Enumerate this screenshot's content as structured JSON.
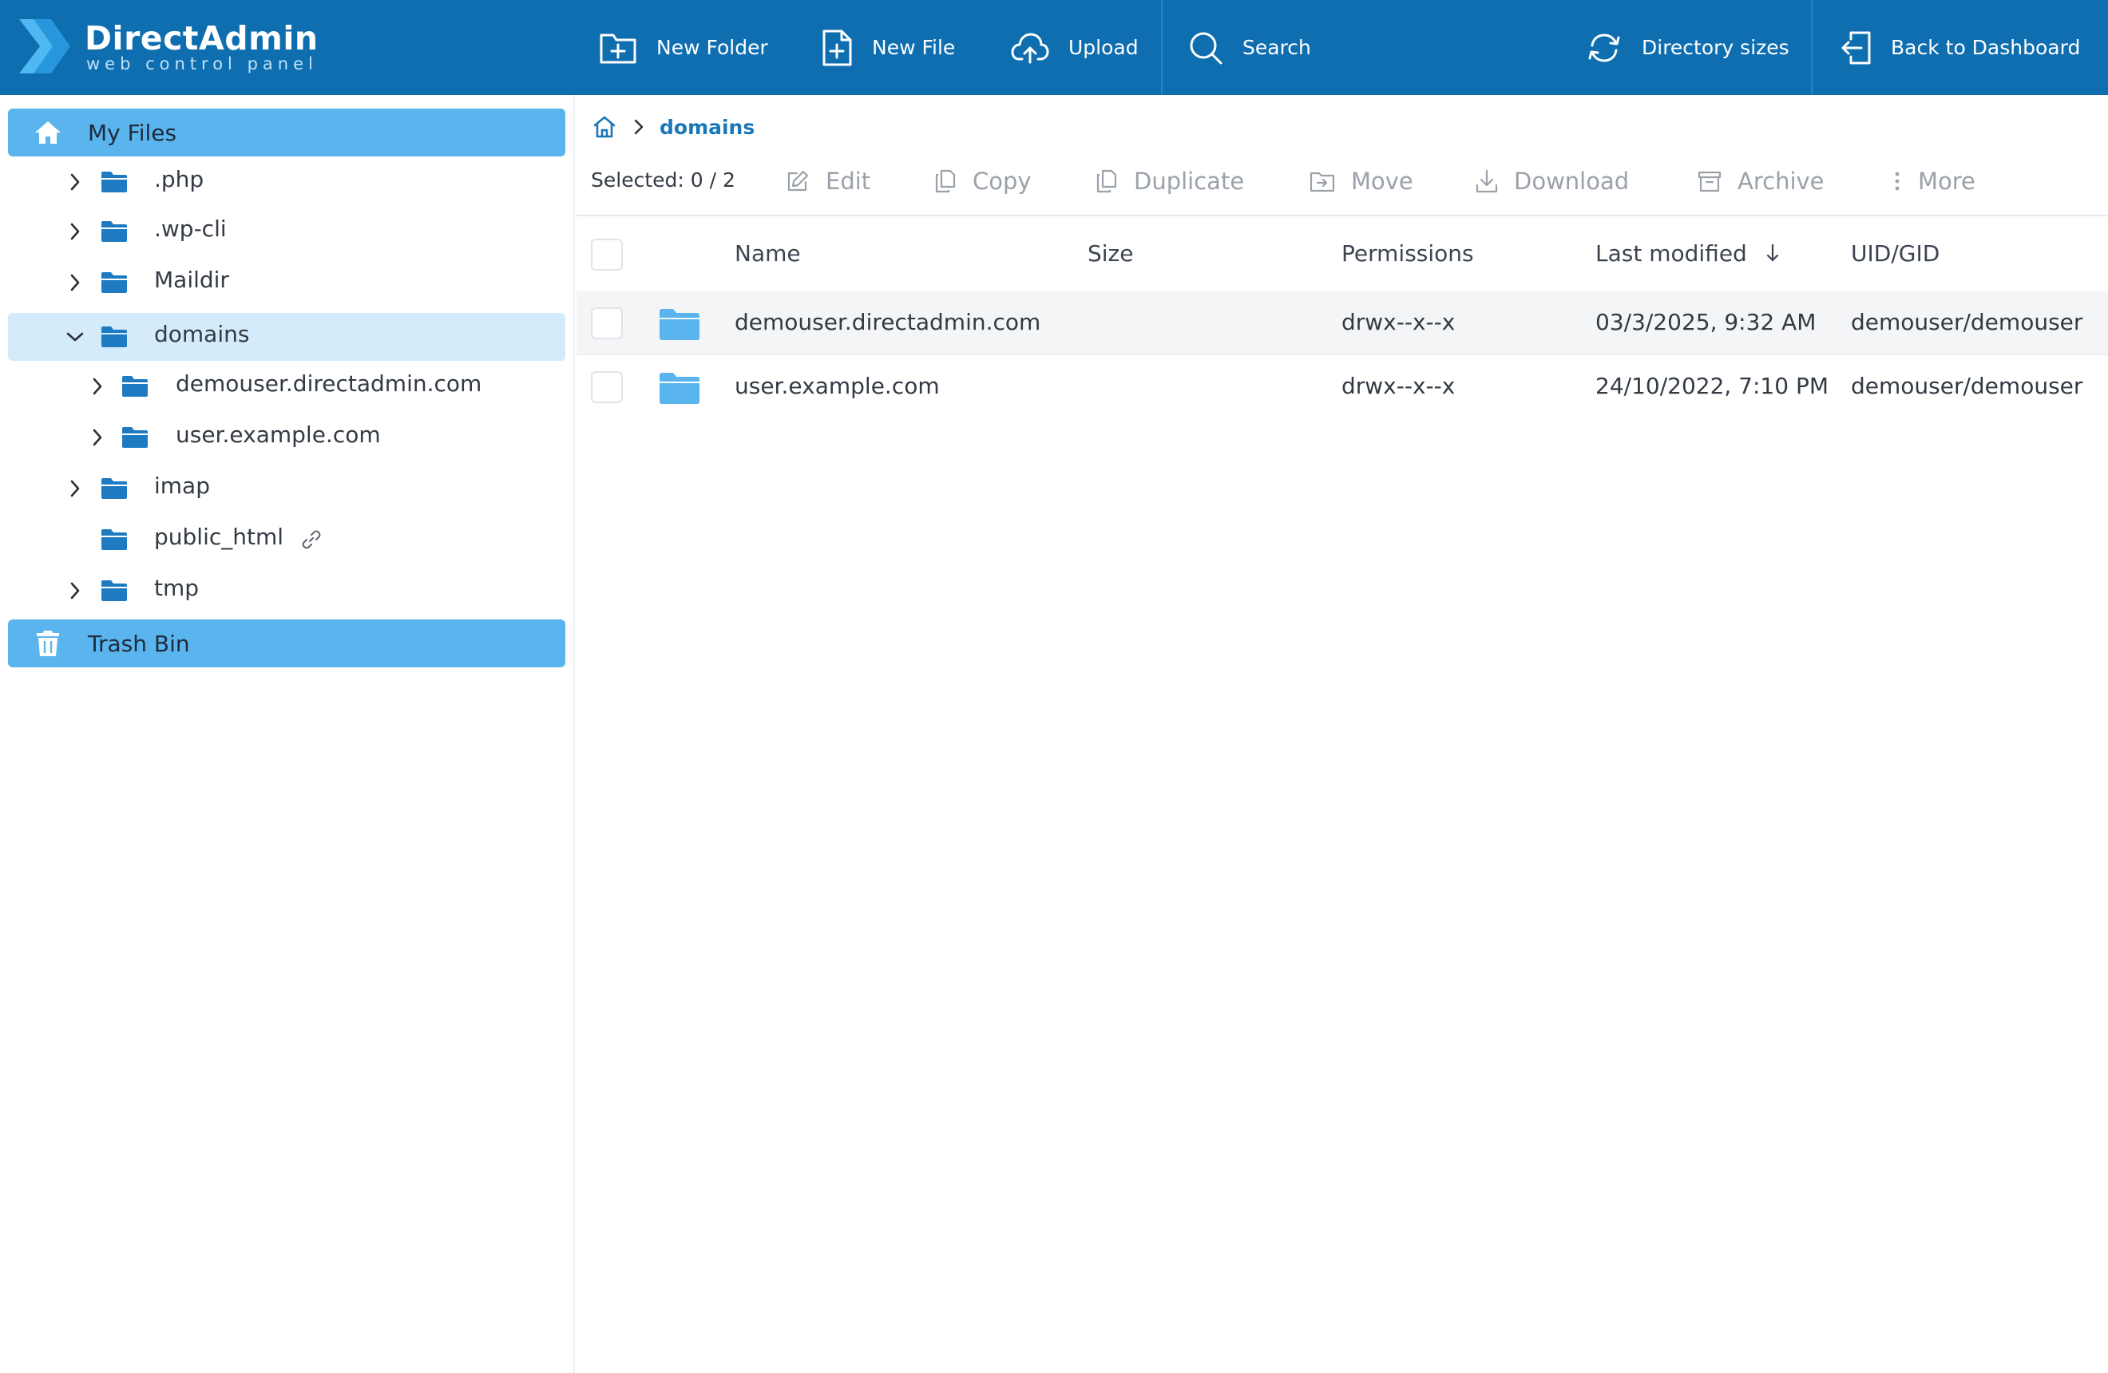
{
  "header": {
    "logo_title": "DirectAdmin",
    "logo_subtitle": "web control panel",
    "buttons": {
      "new_folder": "New Folder",
      "new_file": "New File",
      "upload": "Upload",
      "search": "Search",
      "directory_sizes": "Directory sizes",
      "back_to_dashboard": "Back to Dashboard"
    }
  },
  "sidebar": {
    "my_files": "My Files",
    "trash_bin": "Trash Bin",
    "tree": {
      "php": ".php",
      "wpcli": ".wp-cli",
      "maildir": "Maildir",
      "domains": "domains",
      "demouser": "demouser.directadmin.com",
      "userexample": "user.example.com",
      "imap": "imap",
      "public_html": "public_html",
      "tmp": "tmp"
    }
  },
  "breadcrumb": {
    "current": "domains"
  },
  "actions": {
    "selected_label": "Selected:",
    "selected_count": "0 / 2",
    "edit": "Edit",
    "copy": "Copy",
    "duplicate": "Duplicate",
    "move": "Move",
    "download": "Download",
    "archive": "Archive",
    "more": "More"
  },
  "table": {
    "columns": {
      "name": "Name",
      "size": "Size",
      "permissions": "Permissions",
      "last_modified": "Last modified",
      "uid_gid": "UID/GID"
    },
    "rows": [
      {
        "name": "demouser.directadmin.com",
        "size": "",
        "permissions": "drwx--x--x",
        "modified": "03/3/2025, 9:32 AM",
        "owner": "demouser/demouser"
      },
      {
        "name": "user.example.com",
        "size": "",
        "permissions": "drwx--x--x",
        "modified": "24/10/2022, 7:10 PM",
        "owner": "demouser/demouser"
      }
    ]
  },
  "colors": {
    "header_bg": "#0e6eb0",
    "sidebar_active": "#5ab4ee",
    "tree_selected": "#d3ebfb",
    "folder_icon": "#1e7bc2",
    "table_folder_icon": "#5ab4ee",
    "link_accent": "#1a77b8"
  }
}
